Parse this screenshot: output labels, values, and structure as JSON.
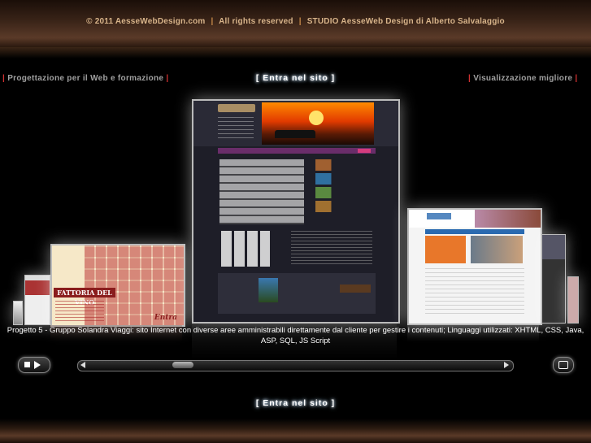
{
  "header": {
    "copyright": "© 2011 AesseWebDesign.com",
    "rights": "All rights reserved",
    "studio": "STUDIO AesseWeb Design di Alberto Salvalaggio",
    "separator": "|"
  },
  "left_label": "Progettazione per il Web e formazione",
  "right_label": "Visualizzazione migliore",
  "enter_top": "[ Entra nel sito ]",
  "enter_bottom": "[ Entra nel sito ]",
  "bracket": "|",
  "caption": "Progetto 5 - Gruppo Solandra Viaggi: sito Internet con diverse aree amministrabili direttamente dal cliente per gestire i contenuti; Linguaggi utilizzati: XHTML, CSS, Java, ASP, SQL, JS Script",
  "left_card_title": "FATTORIA DEL VINO",
  "left_card_link": "Entra",
  "colors": {
    "accent": "#d03030",
    "header_text": "#d8b48a",
    "separator": "#c88b4a"
  },
  "icons": {
    "play": "play-stop-icon",
    "fullscreen": "fullscreen-icon",
    "prev": "arrow-left-icon",
    "next": "arrow-right-icon"
  }
}
